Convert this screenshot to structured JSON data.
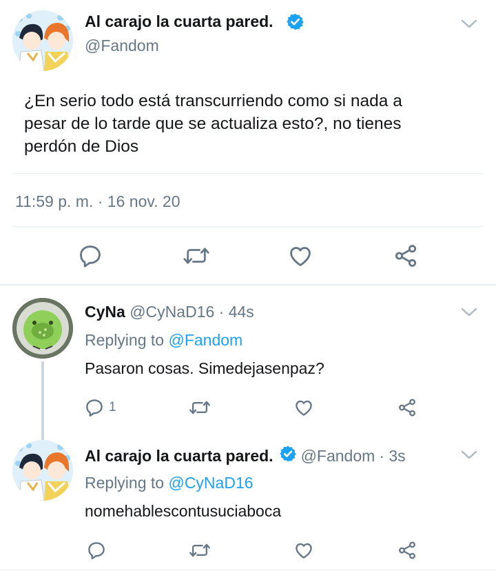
{
  "main_tweet": {
    "display_name": "Al carajo la cuarta pared.",
    "handle": "@Fandom",
    "text_lines": [
      "¿En serio todo está transcurriendo como si nada a",
      "pesar de lo tarde que se actualiza esto?, no tienes",
      "perdón de Dios"
    ],
    "timestamp": "11:59 p. m. · 16 nov. 20"
  },
  "replies": [
    {
      "display_name": "CyNa",
      "handle": "@CyNaD16",
      "time": "· 44s",
      "replying_prefix": "Replying to",
      "replying_to": "@Fandom",
      "text": "Pasaron cosas. Simedejasenpaz?",
      "reply_count": "1"
    },
    {
      "display_name": "Al carajo la cuarta pared.",
      "handle": "@Fandom",
      "time": "· 3s",
      "replying_prefix": "Replying to",
      "replying_to": "@CyNaD16",
      "text": "nomehablescontusuciaboca"
    }
  ],
  "icons": [
    "chevron-down-icon",
    "verified-badge-icon",
    "reply-icon",
    "retweet-icon",
    "like-icon",
    "share-icon"
  ],
  "colors": {
    "accent": "#1da1f2",
    "muted": "#657786",
    "text": "#14171a",
    "divider": "#e6ecf0"
  }
}
